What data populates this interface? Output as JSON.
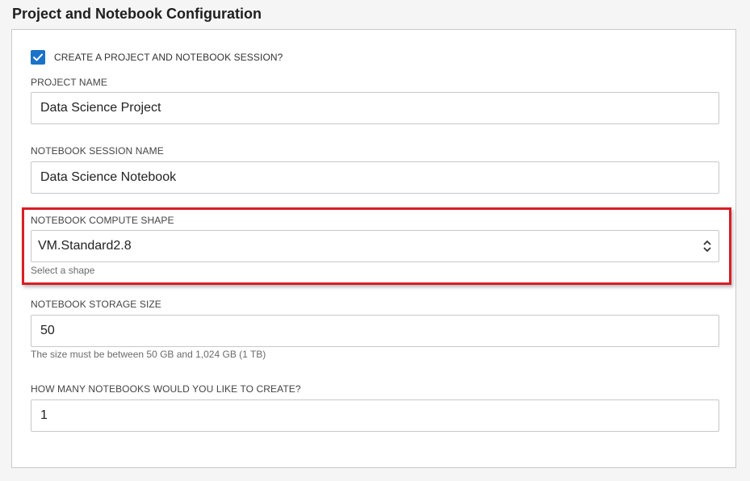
{
  "section": {
    "title": "Project and Notebook Configuration"
  },
  "create_session": {
    "label": "CREATE A PROJECT AND NOTEBOOK SESSION?",
    "checked": true
  },
  "project_name": {
    "label": "PROJECT NAME",
    "value": "Data Science Project"
  },
  "notebook_session_name": {
    "label": "NOTEBOOK SESSION NAME",
    "value": "Data Science Notebook"
  },
  "compute_shape": {
    "label": "NOTEBOOK COMPUTE SHAPE",
    "selected": "VM.Standard2.8",
    "helper": "Select a shape"
  },
  "storage_size": {
    "label": "NOTEBOOK STORAGE SIZE",
    "value": "50",
    "helper": "The size must be between 50 GB and 1,024 GB (1 TB)"
  },
  "notebook_count": {
    "label": "HOW MANY NOTEBOOKS WOULD YOU LIKE TO CREATE?",
    "value": "1"
  },
  "colors": {
    "accent": "#1a73c8",
    "highlight": "#d81e26",
    "border": "#c8c8c8"
  },
  "icons": {
    "checkbox": "check-icon",
    "select": "chevron-up-down-icon"
  }
}
